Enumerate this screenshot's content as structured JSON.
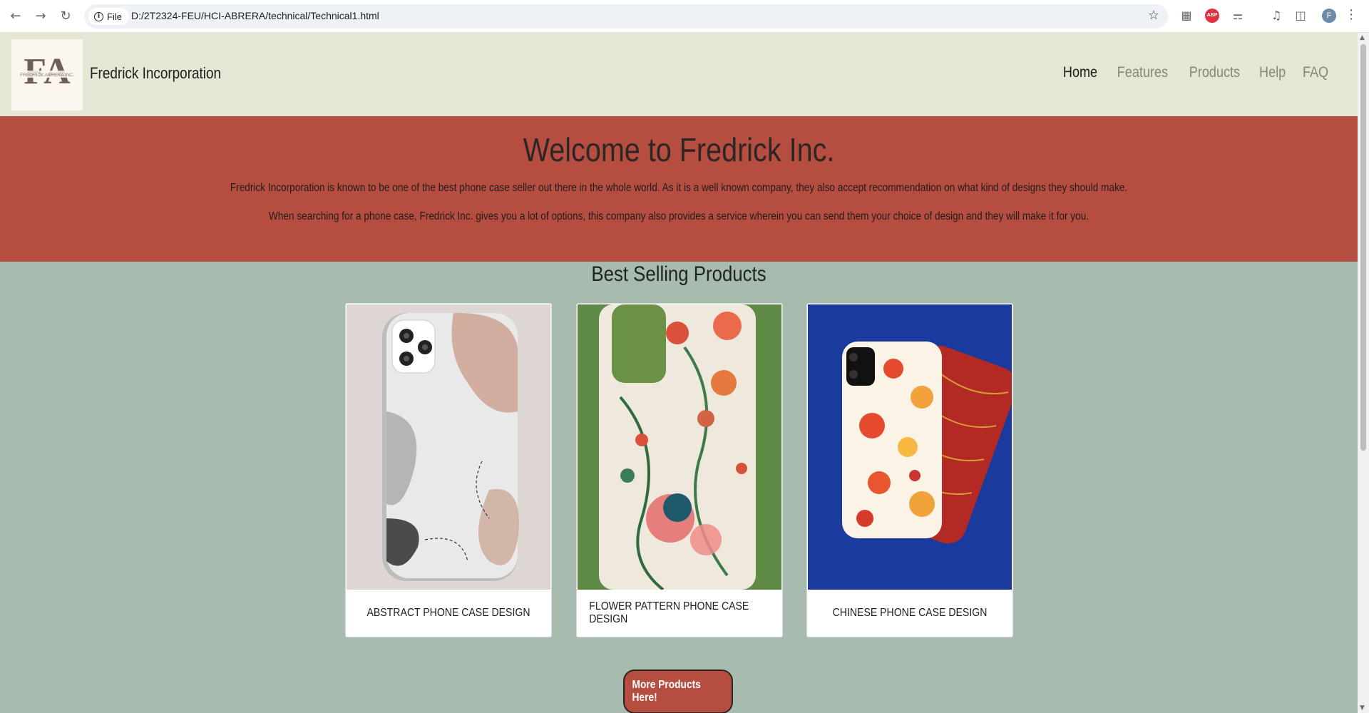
{
  "browser": {
    "chip_label": "File",
    "url": "D:/2T2324-FEU/HCI-ABRERA/technical/Technical1.html",
    "avatar_initial": "F",
    "icons": [
      "back-icon",
      "forward-icon",
      "reload-icon",
      "info-icon",
      "star-icon",
      "extension-icon",
      "adblock-icon",
      "puzzle-icon",
      "media-icon",
      "sidepanel-icon",
      "menu-icon"
    ]
  },
  "header": {
    "logo_text": "FREDRICK ABRERA INC.",
    "logo_mark": "FA",
    "brand": "Fredrick Incorporation",
    "nav": [
      {
        "label": "Home",
        "active": true
      },
      {
        "label": "Features",
        "active": false
      },
      {
        "label": "Products",
        "active": false
      },
      {
        "label": "Help",
        "active": false
      },
      {
        "label": "FAQ",
        "active": false
      }
    ]
  },
  "hero": {
    "title": "Welcome to Fredrick Inc.",
    "paragraph1": "Fredrick Incorporation is known to be one of the best phone case seller out there in the whole world. As it is a well known company, they also accept recommendation on what kind of designs they should make.",
    "paragraph2": "When searching for a phone case, Fredrick Inc. gives you a lot of options, this company also provides a service wherein you can send them your choice of design and they will make it for you."
  },
  "products": {
    "title": "Best Selling Products",
    "items": [
      {
        "label": "ABSTRACT PHONE CASE DESIGN"
      },
      {
        "label": "FLOWER PATTERN PHONE CASE DESIGN"
      },
      {
        "label": "CHINESE PHONE CASE DESIGN"
      }
    ],
    "more_button": "More Products Here!"
  },
  "colors": {
    "header_bg": "#e5e6d4",
    "hero_bg": "#b54e40",
    "page_bg": "#a7bcae",
    "card_bg": "#ffffff"
  }
}
